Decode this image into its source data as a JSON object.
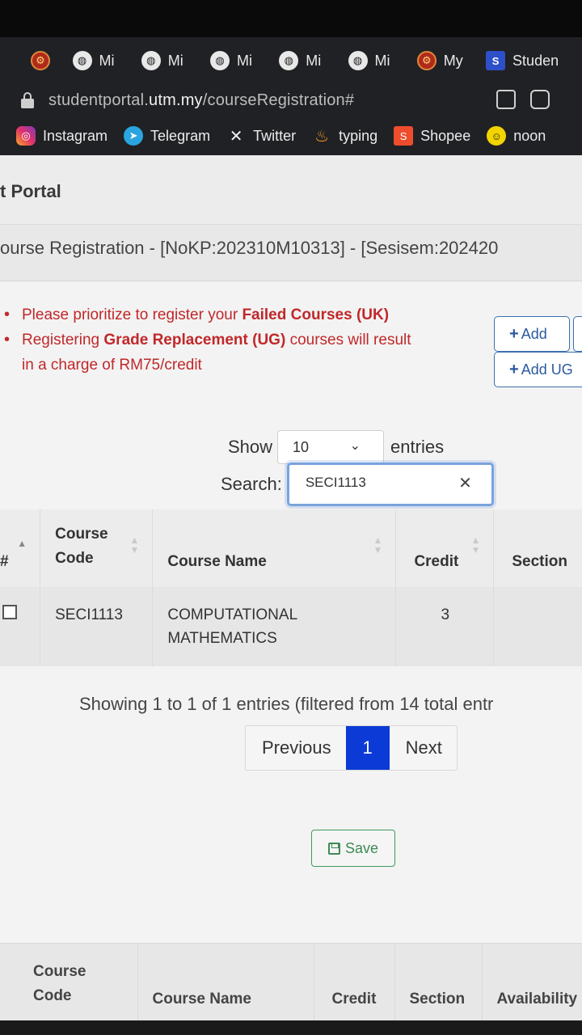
{
  "browser": {
    "tabs": [
      {
        "label": "",
        "icon": "utm-crest-icon"
      },
      {
        "label": "Mi",
        "icon": "globe-icon"
      },
      {
        "label": "Mi",
        "icon": "globe-icon"
      },
      {
        "label": "Mi",
        "icon": "globe-icon"
      },
      {
        "label": "Mi",
        "icon": "globe-icon"
      },
      {
        "label": "Mi",
        "icon": "globe-icon"
      },
      {
        "label": "My",
        "icon": "utm-crest-icon"
      },
      {
        "label": "Studen",
        "icon": "s-logo-icon"
      }
    ],
    "url_prefix": "studentportal.",
    "url_domain": "utm.my",
    "url_path": "/courseRegistration#",
    "bookmarks": [
      {
        "label": "Instagram",
        "icon": "instagram-icon"
      },
      {
        "label": "Telegram",
        "icon": "telegram-icon"
      },
      {
        "label": "Twitter",
        "icon": "x-twitter-icon"
      },
      {
        "label": "typing",
        "icon": "fire-icon"
      },
      {
        "label": "Shopee",
        "icon": "shopee-icon"
      },
      {
        "label": "noon",
        "icon": "noon-icon"
      }
    ]
  },
  "page": {
    "portal_title": "t Portal",
    "registration_title": "ourse Registration - [NoKP:202310M10313] - [Sesisem:202420",
    "notes": {
      "note1_pre": "Please prioritize to register your ",
      "note1_bold": "Failed Courses (UK)",
      "note2_pre": "Registering ",
      "note2_bold": "Grade Replacement (UG)",
      "note2_post": " courses will result",
      "note2_cont": "in a charge of RM75/credit"
    },
    "buttons": {
      "add": "Add",
      "add_ug": "Add UG",
      "save": "Save"
    },
    "show_label": "Show",
    "entries_value": "10",
    "entries_label": "entries",
    "search_label": "Search:",
    "search_value": "SECI1113"
  },
  "table": {
    "headers": {
      "hash": "#",
      "course_code_1": "Course",
      "course_code_2": "Code",
      "course_name": "Course Name",
      "credit": "Credit",
      "section": "Section"
    },
    "rows": [
      {
        "code": "SECI1113",
        "name_1": "COMPUTATIONAL",
        "name_2": "MATHEMATICS",
        "credit": "3",
        "section": ""
      }
    ],
    "info": "Showing 1 to 1 of 1 entries (filtered from 14 total entr",
    "pagination": {
      "previous": "Previous",
      "current": "1",
      "next": "Next"
    }
  },
  "table2": {
    "headers": {
      "course_code_1": "Course",
      "course_code_2": "Code",
      "course_name": "Course Name",
      "credit": "Credit",
      "section": "Section",
      "availability": "Availability"
    }
  },
  "colors": {
    "accent_blue": "#0b3ad6",
    "warning_red": "#c0282a",
    "save_green": "#3e8a55"
  }
}
